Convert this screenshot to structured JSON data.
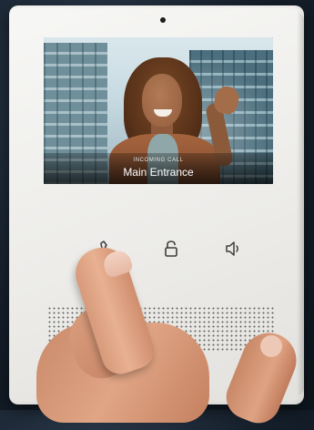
{
  "video": {
    "caption_small": "INCOMING CALL",
    "caption_main": "Main Entrance"
  },
  "controls": [
    {
      "icon": "call-handset-icon"
    },
    {
      "icon": "unlock-icon"
    },
    {
      "icon": "speaker-volume-icon"
    }
  ],
  "colors": {
    "panel": "#efeeeb",
    "icon": "#3c3c3c",
    "background": "#16202c"
  }
}
